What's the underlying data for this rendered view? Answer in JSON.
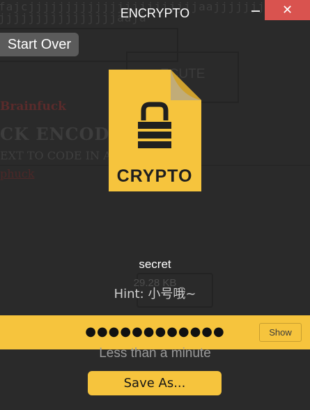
{
  "window": {
    "title": "ENCRYPTO",
    "minimize_icon": "minimize-icon",
    "close_label": "✕",
    "close_color": "#d9534f"
  },
  "start_over": {
    "label": "Start Over"
  },
  "background_page": {
    "line1": "fajcjjjjjjjjjjjjjjjjjjjjjjjaajjjjjjj",
    "line2": "jjjjjjjjjjjjjjjjaaja",
    "execute_label": "ECUTE",
    "brainfuck": "Brainfuck",
    "encoder_heading": "CK ENCODER",
    "subline": "EXT TO CODE IN A",
    "link": "phuck"
  },
  "file": {
    "icon": "crypto-file-icon",
    "icon_label": "CRYPTO",
    "icon_color": "#f6c43d",
    "name": "secret",
    "size": "29.28 KB",
    "hint": "Hint: 小号哦~"
  },
  "password": {
    "masked_value": "●●●●●●●●●●●●",
    "show_label": "Show",
    "bar_color": "#f6c43d"
  },
  "eta": "Less than a minute",
  "save_as": {
    "label": "Save As..."
  }
}
